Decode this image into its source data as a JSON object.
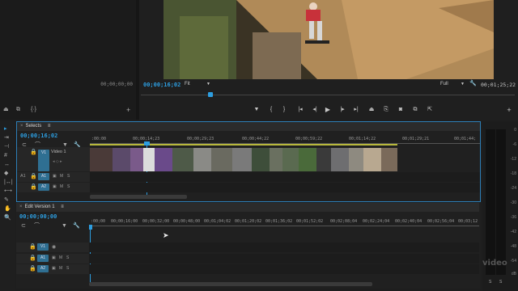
{
  "source_monitor": {
    "timecode": "00;00;00;00"
  },
  "program_monitor": {
    "timecode": "00;00;16;02",
    "fit": "Fit",
    "quality": "Full",
    "duration": "00;01;25;22"
  },
  "selects": {
    "tab_label": "Selects",
    "timecode": "00;00;16;02",
    "ruler": [
      ":00:00",
      "00;00;14;23",
      "00;00;29;23",
      "00;00;44;22",
      "00;00;59;22",
      "00;01;14;22",
      "00;01;29;21",
      "00;01;44;"
    ],
    "tracks": {
      "v1_src": "V1",
      "v1_name": "Video 1",
      "a1_src": "A1",
      "a1": "A1",
      "a2": "A2",
      "m": "M",
      "s": "S"
    }
  },
  "edit": {
    "tab_label": "Edit Version 1",
    "timecode": "00;00;00;00",
    "ruler": [
      ":00;00",
      "00;00;16;00",
      "00;00;32;00",
      "00;00;48;00",
      "00;01;04;02",
      "00;01;20;02",
      "00;01;36;02",
      "00;01;52;02",
      "00;02;08;04",
      "00;02;24;04",
      "00;02;40;04",
      "00;02;56;04",
      "00;03;12"
    ],
    "tracks": {
      "v1": "V1",
      "a1": "A1",
      "a2": "A2",
      "m": "M",
      "s": "S"
    }
  },
  "audio_meter": {
    "labels": [
      "0",
      "-6",
      "-12",
      "-18",
      "-24",
      "-30",
      "-36",
      "-42",
      "-48",
      "-54",
      "dB"
    ],
    "solo": [
      "S",
      "S"
    ]
  },
  "watermark": "video"
}
